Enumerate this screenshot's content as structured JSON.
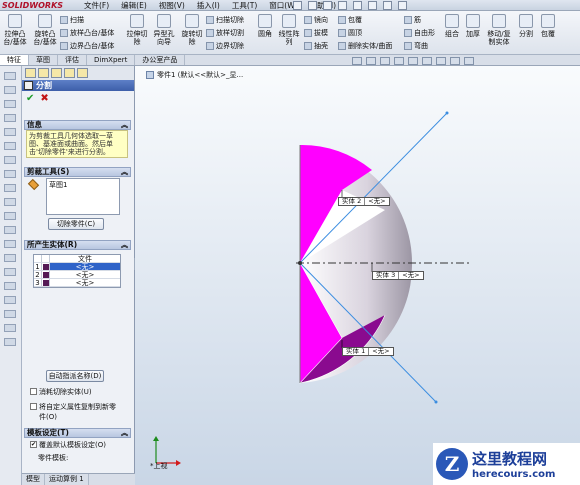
{
  "menubar": {
    "logo": "SOLIDWORKS",
    "items": [
      "文件(F)",
      "编辑(E)",
      "视图(V)",
      "插入(I)",
      "工具(T)",
      "窗口(W)",
      "帮助(H)"
    ]
  },
  "toolbar": {
    "big_buttons": [
      {
        "label": "拉伸凸\n台/基体",
        "icon": "extrude-boss-icon"
      },
      {
        "label": "旋转凸\n台/基体",
        "icon": "revolve-boss-icon"
      },
      {
        "label": "拉伸切\n除",
        "icon": "extrude-cut-icon"
      },
      {
        "label": "异型孔\n向导",
        "icon": "hole-wizard-icon"
      },
      {
        "label": "旋转切\n除",
        "icon": "revolve-cut-icon"
      },
      {
        "label": "圆角",
        "icon": "fillet-icon"
      },
      {
        "label": "线性阵\n列",
        "icon": "linear-pattern-icon"
      },
      {
        "label": "组合",
        "icon": "combine-icon"
      },
      {
        "label": "加厚",
        "icon": "thicken-icon"
      },
      {
        "label": "移动/复\n制实体",
        "icon": "move-copy-body-icon"
      },
      {
        "label": "分割",
        "icon": "split-icon"
      },
      {
        "label": "包覆",
        "icon": "wrap-icon"
      }
    ],
    "small_buttons": [
      {
        "label": "扫描",
        "icon": "sweep-icon"
      },
      {
        "label": "放样凸台/基体",
        "icon": "loft-icon"
      },
      {
        "label": "边界凸台/基体",
        "icon": "boundary-boss-icon"
      },
      {
        "label": "扫描切除",
        "icon": "swept-cut-icon"
      },
      {
        "label": "放样切割",
        "icon": "lofted-cut-icon"
      },
      {
        "label": "边界切除",
        "icon": "boundary-cut-icon"
      },
      {
        "label": "镜向",
        "icon": "mirror-icon"
      },
      {
        "label": "拔模",
        "icon": "draft-icon"
      },
      {
        "label": "抽壳",
        "icon": "shell-icon"
      },
      {
        "label": "包覆",
        "icon": "wrap-small-icon"
      },
      {
        "label": "圆顶",
        "icon": "dome-icon"
      },
      {
        "label": "删除实体/曲面",
        "icon": "delete-body-icon"
      },
      {
        "label": "筋",
        "icon": "rib-icon"
      },
      {
        "label": "自由形",
        "icon": "freeform-icon"
      },
      {
        "label": "弯曲",
        "icon": "flex-icon"
      }
    ]
  },
  "tabs": [
    "特征",
    "草图",
    "评估",
    "DimXpert",
    "办公室产品"
  ],
  "pm": {
    "title": "分割",
    "info_header": "信息",
    "info_text": "为剪裁工具几何体选取一草图、基准面或曲面。然后单击'切除零件'来进行分割。",
    "trim_header": "剪裁工具(S)",
    "trim_item": "草图1",
    "cut_button": "切除零件(C)",
    "bodies_header": "所产生实体(R)",
    "bodies_col_file": "文件",
    "bodies": [
      {
        "num": "1",
        "file": "<无>",
        "selected": true
      },
      {
        "num": "2",
        "file": "<无>",
        "selected": false
      },
      {
        "num": "3",
        "file": "<无>",
        "selected": false
      }
    ],
    "auto_name_button": "自动指派名称(D)",
    "consume_label": "消耗切除实体(U)",
    "custom_props_label": "将自定义属性复制到新零件(O)",
    "template_header": "模板设定(T)",
    "override_label": "覆盖默认模板设定(O)",
    "part_template_label": "零件模板:"
  },
  "bottom_tabs": [
    "模型",
    "运动算例 1"
  ],
  "viewport": {
    "tree_label": "零件1 (默认<<默认>_显...",
    "callouts": [
      {
        "name": "实体 2",
        "file": "<无>"
      },
      {
        "name": "实体 3",
        "file": "<无>"
      },
      {
        "name": "实体 1",
        "file": "<无>"
      }
    ],
    "view_label": "*上视",
    "colors": {
      "magenta": "#ff00ff",
      "dark_magenta": "#8a0a8f",
      "shell_grey": "#c6c0cc",
      "sketch_blue": "#3b8de0"
    }
  },
  "watermark": {
    "logo_letter": "Z",
    "title": "这里教程网",
    "url": "herecours.com"
  }
}
